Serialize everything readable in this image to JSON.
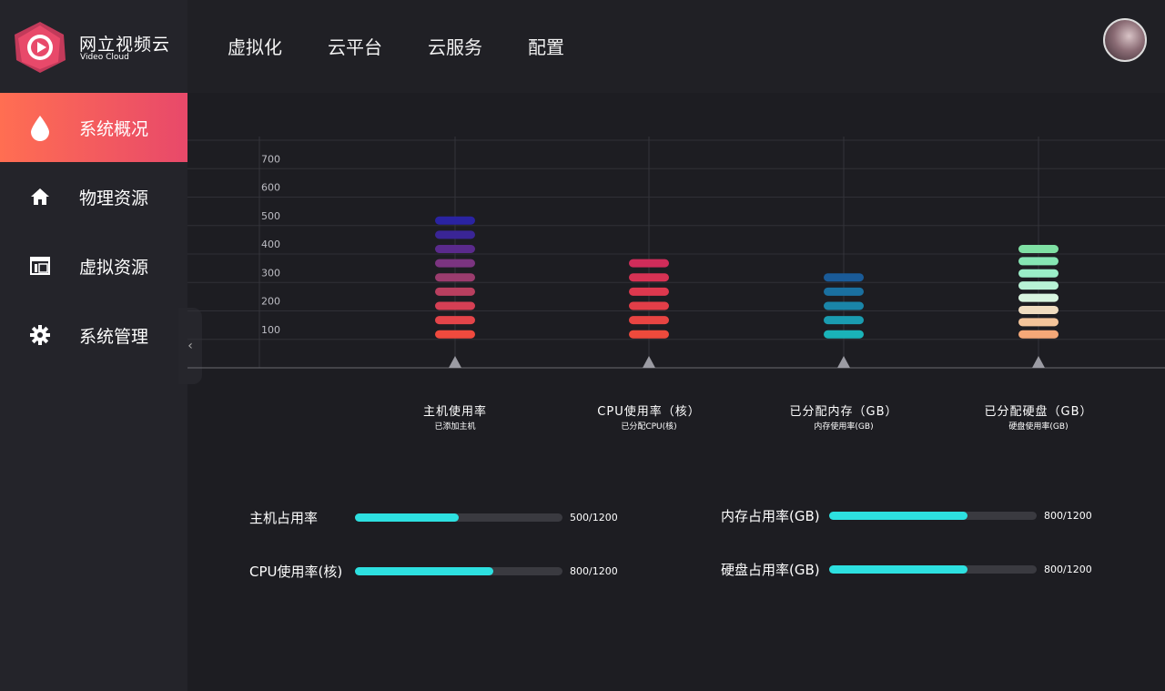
{
  "brand": {
    "title": "网立视频云",
    "subtitle": "Video Cloud",
    "colors": {
      "primary": "#e8496a",
      "accent": "#ff6e52"
    }
  },
  "sidebar": {
    "items": [
      {
        "label": "系统概况",
        "icon": "drop-icon",
        "active": true
      },
      {
        "label": "物理资源",
        "icon": "home-icon",
        "active": false
      },
      {
        "label": "虚拟资源",
        "icon": "window-icon",
        "active": false
      },
      {
        "label": "系统管理",
        "icon": "gear-icon",
        "active": false
      }
    ],
    "collapse_glyph": "‹"
  },
  "topnav": {
    "items": [
      "虚拟化",
      "云平台",
      "云服务",
      "配置"
    ]
  },
  "chart_data": {
    "type": "bar",
    "ylim": [
      0,
      800
    ],
    "yticks": [
      100,
      200,
      300,
      400,
      500,
      600,
      700,
      800
    ],
    "grid": true,
    "categories": [
      {
        "label": "主机使用率",
        "sublabel": "已添加主机",
        "value": 500,
        "colors": [
          "#f04a3e",
          "#e34449",
          "#d53f54",
          "#b93f5f",
          "#9b3c6e",
          "#7b3480",
          "#5a2a8c",
          "#3a2596",
          "#2a23a2"
        ]
      },
      {
        "label": "CPU使用率（核）",
        "sublabel": "已分配CPU(核)",
        "value": 350,
        "colors": [
          "#ee4a3c",
          "#e84442",
          "#e33e48",
          "#dd384e",
          "#d73254",
          "#d02c5a"
        ]
      },
      {
        "label": "已分配内存（GB）",
        "sublabel": "内存使用率(GB)",
        "value": 300,
        "colors": [
          "#1ab3b8",
          "#1a9cb0",
          "#1a85a8",
          "#1a70a0",
          "#1a5b98"
        ]
      },
      {
        "label": "已分配硬盘（GB）",
        "sublabel": "硬盘使用率(GB)",
        "value": 400,
        "colors": [
          "#f5a878",
          "#f3c49a",
          "#f0dcc0",
          "#d8f5e0",
          "#b8f2d6",
          "#9aeec8",
          "#86e6b4",
          "#7fe0a4"
        ]
      }
    ]
  },
  "stats": [
    {
      "label": "主机占用率",
      "value": "500/1200",
      "fraction": 0.5
    },
    {
      "label": "CPU使用率(核)",
      "value": "800/1200",
      "fraction": 0.667
    },
    {
      "label": "内存占用率(GB)",
      "value": "800/1200",
      "fraction": 0.667
    },
    {
      "label": "硬盘占用率(GB)",
      "value": "800/1200",
      "fraction": 0.667
    }
  ]
}
